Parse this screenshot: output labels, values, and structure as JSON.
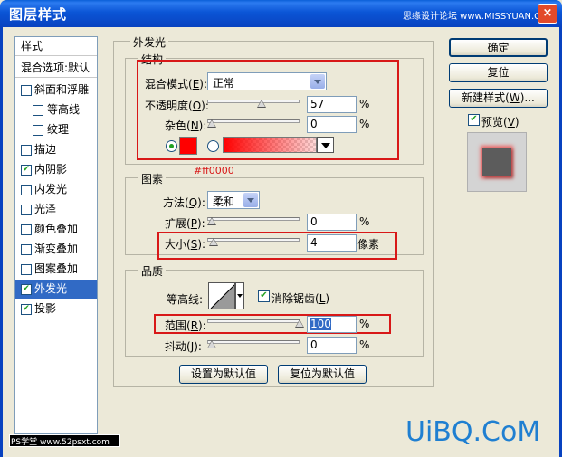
{
  "window": {
    "title": "图层样式",
    "watermark_top": "思缘设计论坛 www.MISSYUAN.COM",
    "close_glyph": "×"
  },
  "sidebar": {
    "header": "样式",
    "blend_options": "混合选项:默认",
    "items": [
      {
        "label": "斜面和浮雕",
        "checked": false,
        "indent": false
      },
      {
        "label": "等高线",
        "checked": false,
        "indent": true
      },
      {
        "label": "纹理",
        "checked": false,
        "indent": true
      },
      {
        "label": "描边",
        "checked": false,
        "indent": false
      },
      {
        "label": "内阴影",
        "checked": true,
        "indent": false
      },
      {
        "label": "内发光",
        "checked": false,
        "indent": false
      },
      {
        "label": "光泽",
        "checked": false,
        "indent": false
      },
      {
        "label": "颜色叠加",
        "checked": false,
        "indent": false
      },
      {
        "label": "渐变叠加",
        "checked": false,
        "indent": false
      },
      {
        "label": "图案叠加",
        "checked": false,
        "indent": false
      },
      {
        "label": "外发光",
        "checked": true,
        "indent": false,
        "selected": true
      },
      {
        "label": "投影",
        "checked": true,
        "indent": false
      }
    ],
    "check_glyph": "✔"
  },
  "outer_glow": {
    "title": "外发光",
    "structure": {
      "title": "结构",
      "blend_mode_label": "混合模式(",
      "blend_mode_key": "E",
      "blend_mode_suffix": "):",
      "blend_mode_value": "正常",
      "opacity_label": "不透明度(",
      "opacity_key": "O",
      "opacity_suffix": "):",
      "opacity_value": "57",
      "opacity_level": 57,
      "noise_label": "杂色(",
      "noise_key": "N",
      "noise_suffix": "):",
      "noise_value": "0",
      "noise_level": 0,
      "percent": "%",
      "color_hex": "#ff0000",
      "color_caption": "#ff0000"
    },
    "elements": {
      "title": "图素",
      "technique_label": "方法(",
      "technique_key": "Q",
      "technique_suffix": "):",
      "technique_value": "柔和",
      "spread_label": "扩展(",
      "spread_key": "P",
      "spread_suffix": "):",
      "spread_value": "0",
      "spread_level": 0,
      "spread_unit": "%",
      "size_label": "大小(",
      "size_key": "S",
      "size_suffix": "):",
      "size_value": "4",
      "size_level": 2,
      "size_unit": "像素"
    },
    "quality": {
      "title": "品质",
      "contour_label": "等高线:",
      "antialias_label": "消除锯齿(",
      "antialias_key": "L",
      "antialias_suffix": ")",
      "antialias_checked": true,
      "range_label": "范围(",
      "range_key": "R",
      "range_suffix": "):",
      "range_value": "100",
      "range_level": 100,
      "range_unit": "%",
      "jitter_label": "抖动(",
      "jitter_key": "J",
      "jitter_suffix": "):",
      "jitter_value": "0",
      "jitter_level": 0,
      "jitter_unit": "%"
    },
    "make_default": "设置为默认值",
    "reset_default": "复位为默认值"
  },
  "actions": {
    "ok": "确定",
    "reset": "复位",
    "new_style_prefix": "新建样式(",
    "new_style_key": "W",
    "new_style_suffix": ")...",
    "preview_prefix": "预览(",
    "preview_key": "V",
    "preview_suffix": ")",
    "preview_checked": true
  },
  "footer": {
    "watermark_left": "PS学堂 www.52psxt.com",
    "watermark_right": "UiBQ.CoM"
  },
  "colors": {
    "highlight_red": "#d81818",
    "selection_blue": "#316ac5",
    "glow_red": "#ff0000"
  }
}
